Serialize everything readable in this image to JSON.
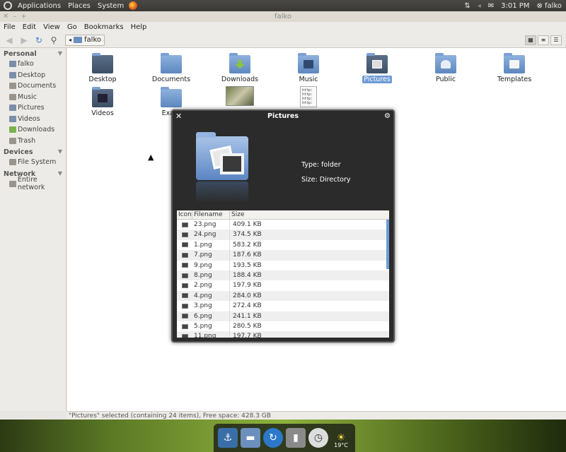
{
  "top_panel": {
    "menus": [
      "Applications",
      "Places",
      "System"
    ],
    "clock": "3:01 PM",
    "user": "falko"
  },
  "window": {
    "title": "falko"
  },
  "menubar": [
    "File",
    "Edit",
    "View",
    "Go",
    "Bookmarks",
    "Help"
  ],
  "toolbar": {
    "location": "falko"
  },
  "sidebar": {
    "sections": [
      {
        "title": "Personal",
        "items": [
          "falko",
          "Desktop",
          "Documents",
          "Music",
          "Pictures",
          "Videos",
          "Downloads",
          "Trash"
        ]
      },
      {
        "title": "Devices",
        "items": [
          "File System"
        ]
      },
      {
        "title": "Network",
        "items": [
          "Entire network"
        ]
      }
    ]
  },
  "icons": [
    {
      "label": "Desktop"
    },
    {
      "label": "Documents"
    },
    {
      "label": "Downloads"
    },
    {
      "label": "Music"
    },
    {
      "label": "Pictures"
    },
    {
      "label": "Public"
    },
    {
      "label": "Templates"
    },
    {
      "label": "Videos"
    },
    {
      "label": "Exam"
    },
    {
      "label": ""
    },
    {
      "label": ""
    }
  ],
  "textfile_preview": "http:\nhttp:\nhttp:\nhttp:",
  "statusbar": "\"Pictures\" selected (containing 24 items), Free space: 428.3 GB",
  "popup": {
    "title": "Pictures",
    "type_label": "Type: folder",
    "size_label": "Size: Directory",
    "columns": [
      "Icon",
      "Filename",
      "Size"
    ],
    "files": [
      {
        "name": "23.png",
        "size": "409.1 KB"
      },
      {
        "name": "24.png",
        "size": "374.5 KB"
      },
      {
        "name": "1.png",
        "size": "583.2 KB"
      },
      {
        "name": "7.png",
        "size": "187.6 KB"
      },
      {
        "name": "9.png",
        "size": "193.5 KB"
      },
      {
        "name": "8.png",
        "size": "188.4 KB"
      },
      {
        "name": "2.png",
        "size": "197.9 KB"
      },
      {
        "name": "4.png",
        "size": "284.0 KB"
      },
      {
        "name": "3.png",
        "size": "272.4 KB"
      },
      {
        "name": "6.png",
        "size": "241.1 KB"
      },
      {
        "name": "5.png",
        "size": "280.5 KB"
      },
      {
        "name": "11.png",
        "size": "197.7 KB"
      }
    ]
  },
  "dock": {
    "weather_temp": "19°C"
  }
}
